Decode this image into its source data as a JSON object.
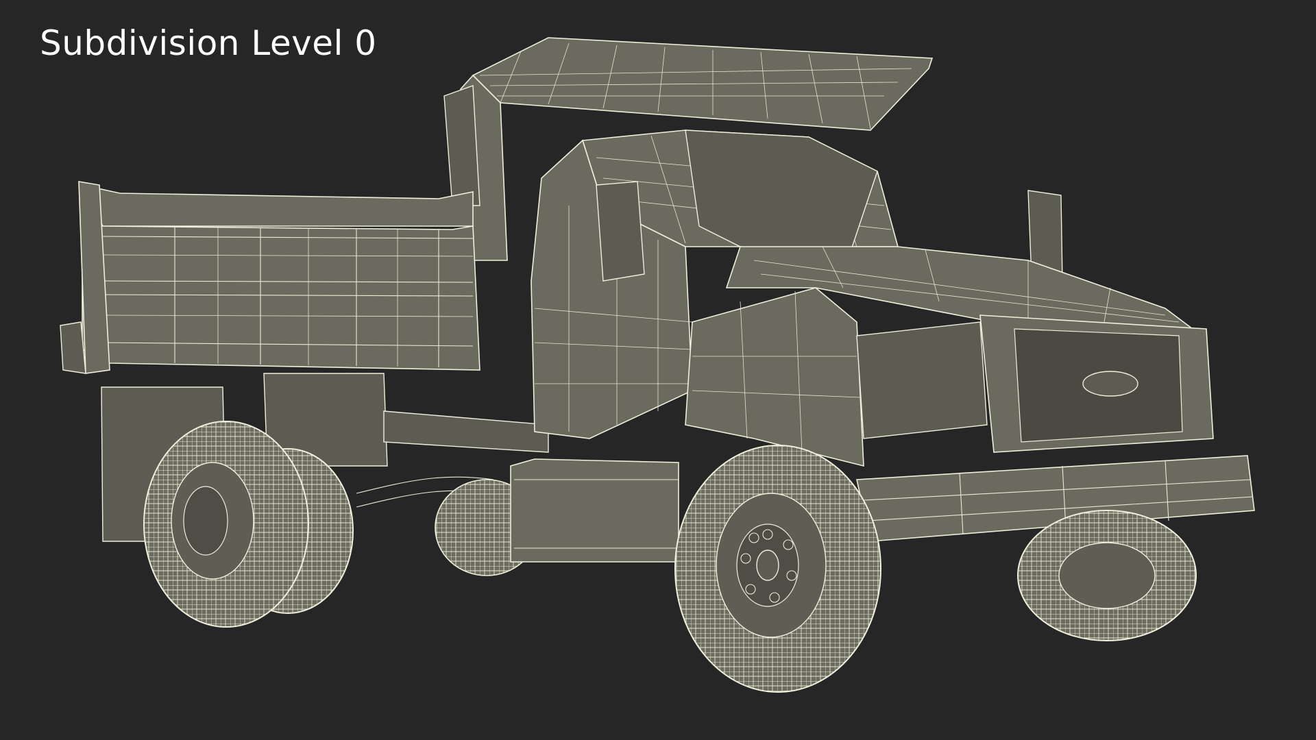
{
  "caption": {
    "text": "Subdivision Level 0"
  },
  "viewport": {
    "background_color": "#262626",
    "mesh_fill_color": "#6a6a5e",
    "wire_color": "#efefdc",
    "subject": "dump truck wireframe render"
  }
}
